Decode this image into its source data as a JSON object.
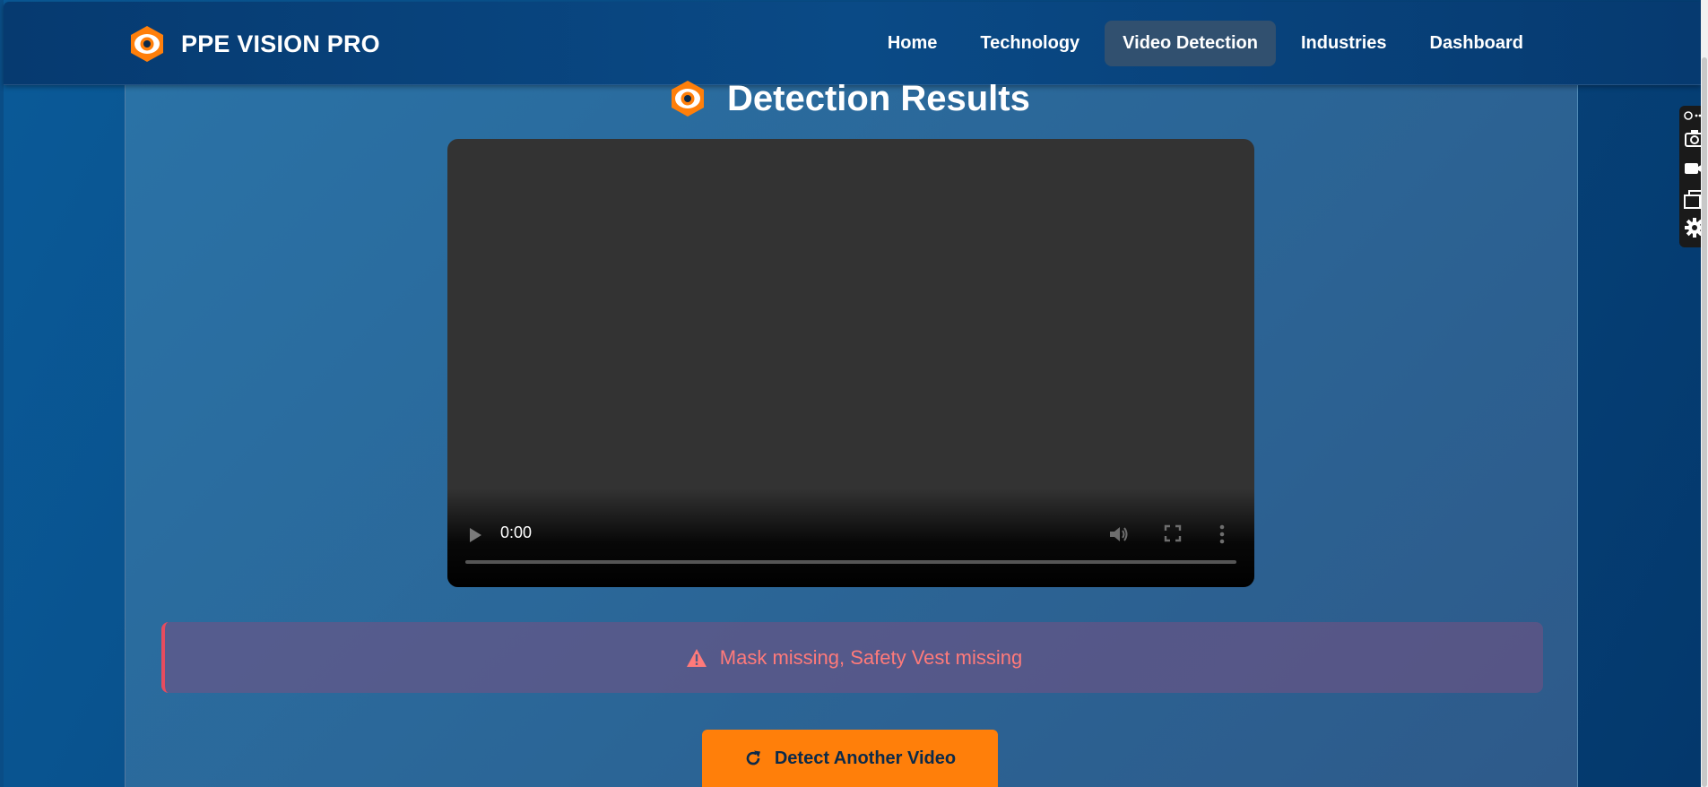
{
  "app": {
    "brand_name": "PPE VISION PRO",
    "brand_logo_icon": "hexagon-eye-logo-icon",
    "accent_color": "#ff7f0a",
    "nav_bg": "#063a70"
  },
  "nav": {
    "items": [
      {
        "label": "Home",
        "active": false
      },
      {
        "label": "Technology",
        "active": false
      },
      {
        "label": "Video Detection",
        "active": true
      },
      {
        "label": "Industries",
        "active": false
      },
      {
        "label": "Dashboard",
        "active": false
      }
    ]
  },
  "results": {
    "title": "Detection Results",
    "title_icon": "hexagon-eye-logo-icon"
  },
  "video": {
    "current_time": "0:00",
    "progress": 0,
    "controls": [
      "play-icon",
      "volume-icon",
      "fullscreen-icon",
      "more-vert-icon"
    ]
  },
  "alert": {
    "icon": "warning-triangle-icon",
    "message": "Mask missing, Safety Vest missing",
    "color": "#ff7a7a"
  },
  "actions": {
    "detect_another_label": "Detect Another Video",
    "detect_another_icon": "redo-icon"
  },
  "tool_strip": {
    "icons": [
      "link-more-icon",
      "camera-icon",
      "video-camera-icon",
      "windows-icon",
      "gear-icon"
    ]
  }
}
